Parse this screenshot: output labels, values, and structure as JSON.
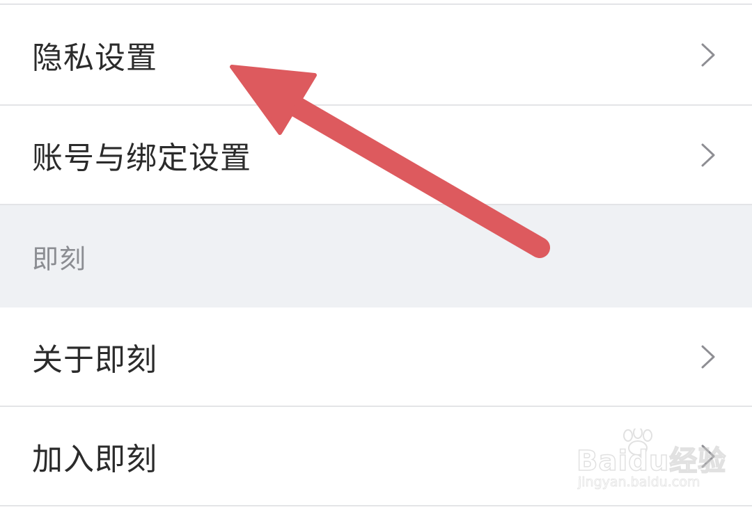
{
  "settings": {
    "rows_top": [
      {
        "label": "隐私设置"
      },
      {
        "label": "账号与绑定设置"
      }
    ],
    "section": {
      "title": "即刻",
      "rows": [
        {
          "label": "关于即刻"
        },
        {
          "label": "加入即刻"
        }
      ]
    }
  },
  "overlay": {
    "arrow_color": "#dd5a5e"
  },
  "watermark": {
    "brand": "Bai 经验",
    "brand_text": "Baidu经验",
    "url": "jingyan.baidu.com"
  },
  "colors": {
    "background": "#ffffff",
    "section_background": "#eff1f4",
    "divider": "#e3e4e7",
    "label_text": "#2b2b2b",
    "section_text": "#8b8d92",
    "chevron": "#8e8e93"
  },
  "icons": {
    "chevron": "chevron-right-icon",
    "annotation": "red-arrow-icon",
    "watermark_paw": "paw-icon"
  }
}
